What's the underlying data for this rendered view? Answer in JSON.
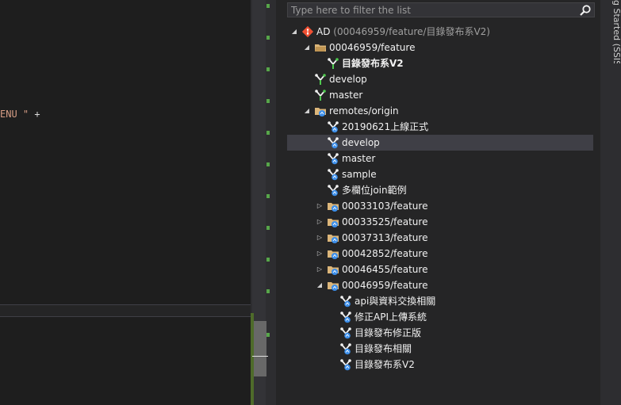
{
  "editor": {
    "code_fragment_str": "ENU \"",
    "code_fragment_op": " +"
  },
  "sidebar": {
    "vertical_tab": "g Started (SSIS)"
  },
  "filter": {
    "placeholder": "Type here to filter the list"
  },
  "tree": {
    "repo": {
      "name": "AD",
      "detail": " (00046959/feature/目錄發布系V2)"
    },
    "local_folder": "00046959/feature",
    "local_current_branch": "目錄發布系V2",
    "local_develop": "develop",
    "local_master": "master",
    "remotes_folder": "remotes/origin",
    "remote_items": [
      "20190621上線正式",
      "develop",
      "master",
      "sample",
      "多欄位join範例",
      "00033103/feature",
      "00033525/feature",
      "00037313/feature",
      "00042852/feature",
      "00046455/feature",
      "00046959/feature"
    ],
    "sub_items": [
      "api與資料交換相關",
      "修正API上傳系統",
      "目錄發布修正版",
      "目錄發布相關",
      "目錄發布系V2"
    ]
  },
  "colors": {
    "accent_git": "#f05033",
    "branch_green": "#4ec94e",
    "remote_blue": "#3b8eea",
    "selected_row": "#3f3f46"
  },
  "icons": {
    "repo": "git-repo-icon",
    "folder": "folder-icon",
    "branch": "branch-icon",
    "remote_branch": "remote-branch-icon",
    "search": "search-icon"
  }
}
